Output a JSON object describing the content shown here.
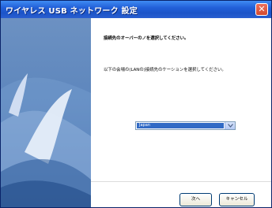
{
  "window": {
    "title": "ワイヤレス USB ネットワーク 設定"
  },
  "titlebar": {
    "close_icon": "close-icon"
  },
  "content": {
    "heading": "接続先のオーバーのノを選択してください。",
    "instruction": "以下の会場の(LANの)接続先のケーションを選択してください。",
    "region_select": {
      "selected": "Japan",
      "arrow_icon": "chevron-down-icon"
    }
  },
  "buttons": {
    "next": "次へ",
    "cancel": "キャンセル"
  }
}
